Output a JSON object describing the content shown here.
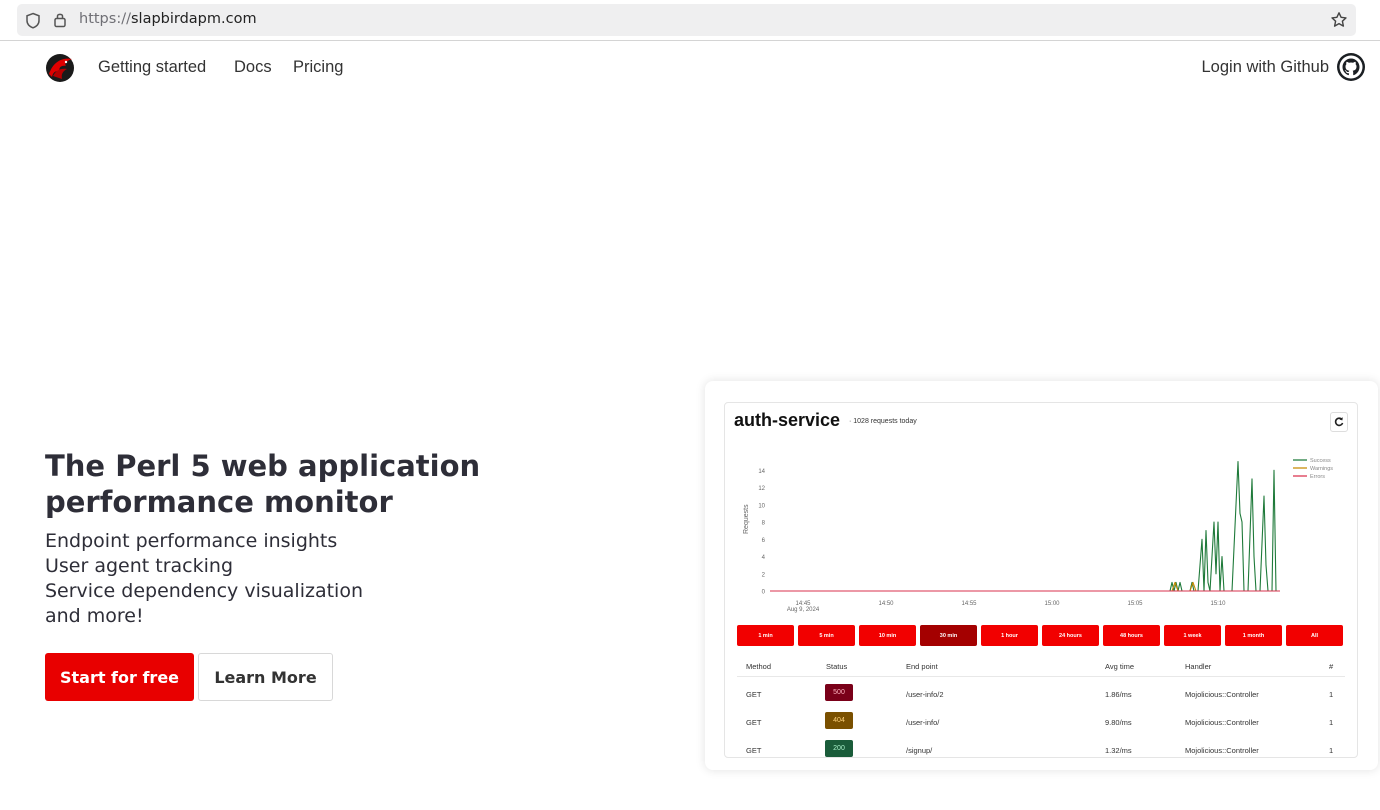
{
  "browser": {
    "url_scheme": "https://",
    "url_host": "slapbirdapm.com"
  },
  "nav": {
    "links": [
      "Getting started",
      "Docs",
      "Pricing"
    ],
    "login_label": "Login with Github"
  },
  "hero": {
    "title": "The Perl 5 web application performance monitor",
    "features": [
      "Endpoint performance insights",
      "User agent tracking",
      "Service dependency visualization",
      "and more!"
    ],
    "primary_cta": "Start for free",
    "secondary_cta": "Learn More"
  },
  "preview": {
    "service_name": "auth-service",
    "request_count": "· 1028 requests today",
    "time_ranges": [
      "1 min",
      "5 min",
      "10 min",
      "30 min",
      "1 hour",
      "24 hours",
      "48 hours",
      "1 week",
      "1 month",
      "All"
    ],
    "active_range": "30 min",
    "table": {
      "headers": [
        "Method",
        "Status",
        "End point",
        "Avg time",
        "Handler",
        "#"
      ],
      "rows": [
        {
          "method": "GET",
          "status": "500",
          "endpoint": "/user-info/2",
          "avg_time": "1.86/ms",
          "handler": "Mojolicious::Controller",
          "count": "1"
        },
        {
          "method": "GET",
          "status": "404",
          "endpoint": "/user-info/",
          "avg_time": "9.80/ms",
          "handler": "Mojolicious::Controller",
          "count": "1"
        },
        {
          "method": "GET",
          "status": "200",
          "endpoint": "/signup/",
          "avg_time": "1.32/ms",
          "handler": "Mojolicious::Controller",
          "count": "1"
        }
      ]
    },
    "status_colors": {
      "500": "#7a0019",
      "404": "#7a5000",
      "200": "#1a5c3a"
    }
  },
  "chart_data": {
    "type": "line",
    "ylabel": "Requests",
    "yticks": [
      0,
      2,
      4,
      6,
      8,
      10,
      12,
      14
    ],
    "ylim": [
      0,
      16
    ],
    "xticks": [
      "14:45",
      "14:50",
      "14:55",
      "15:00",
      "15:05",
      "15:10"
    ],
    "x_date_label": "Aug 9, 2024",
    "legend_placement": "top-right",
    "series": [
      {
        "name": "Success",
        "color": "#1f7a3a",
        "points": [
          [
            0,
            0
          ],
          [
            400,
            0
          ],
          [
            402,
            1
          ],
          [
            404,
            0
          ],
          [
            406,
            1
          ],
          [
            408,
            0
          ],
          [
            410,
            1
          ],
          [
            412,
            0
          ],
          [
            420,
            0
          ],
          [
            422,
            1
          ],
          [
            424,
            0
          ],
          [
            428,
            0
          ],
          [
            432,
            6
          ],
          [
            434,
            0
          ],
          [
            436,
            7
          ],
          [
            438,
            1
          ],
          [
            440,
            0
          ],
          [
            444,
            8
          ],
          [
            446,
            2
          ],
          [
            448,
            8
          ],
          [
            450,
            0
          ],
          [
            452,
            4
          ],
          [
            454,
            0
          ],
          [
            462,
            0
          ],
          [
            468,
            15
          ],
          [
            470,
            9
          ],
          [
            472,
            8
          ],
          [
            474,
            0
          ],
          [
            478,
            0
          ],
          [
            482,
            13
          ],
          [
            484,
            4
          ],
          [
            486,
            0
          ],
          [
            490,
            0
          ],
          [
            494,
            11
          ],
          [
            496,
            3
          ],
          [
            498,
            0
          ],
          [
            502,
            0
          ],
          [
            504,
            14
          ],
          [
            506,
            0
          ],
          [
            510,
            0
          ]
        ]
      },
      {
        "name": "Warnings",
        "color": "#c78a00",
        "points": [
          [
            0,
            0
          ],
          [
            402,
            0
          ],
          [
            405,
            1
          ],
          [
            408,
            0
          ],
          [
            420,
            0
          ],
          [
            423,
            1
          ],
          [
            426,
            0
          ],
          [
            510,
            0
          ]
        ]
      },
      {
        "name": "Errors",
        "color": "#d9304d",
        "points": [
          [
            0,
            0
          ],
          [
            510,
            0
          ]
        ]
      }
    ]
  }
}
